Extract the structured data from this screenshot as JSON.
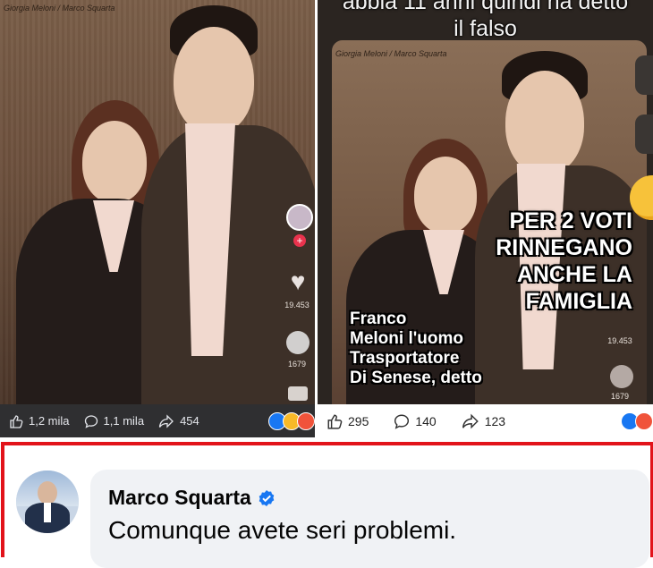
{
  "left_post": {
    "photo_credit": "Giorgia Meloni / Marco Squarta",
    "like_count": "19.453",
    "comment_count": "1679",
    "actions": {
      "likes": "1,2 mila",
      "comments": "1,1 mila",
      "shares": "454"
    }
  },
  "right_post": {
    "caption_top_line1": "abbia 11 anni quindi ha detto",
    "caption_top_line2": "il falso",
    "photo_credit": "Giorgia Meloni / Marco Squarta",
    "overlay_big": [
      "PER 2 VOTI",
      "RINNEGANO",
      "ANCHE LA",
      "FAMIGLIA"
    ],
    "overlay_small": [
      "Franco",
      "Meloni l'uomo",
      "Trasportatore",
      "Di Senese, detto"
    ],
    "side_like_count": "19.453",
    "side_comment_count": "1679",
    "actions": {
      "likes": "295",
      "comments": "140",
      "shares": "123"
    }
  },
  "comment": {
    "author": "Marco Squarta",
    "verified": true,
    "text": "Comunque avete seri problemi."
  },
  "colors": {
    "highlight_border": "#e2131a",
    "verified_blue": "#1877f2",
    "bubble_bg": "#f0f2f5"
  },
  "icons": [
    "like-icon",
    "comment-icon",
    "share-icon",
    "verified-badge-icon",
    "heart-icon"
  ]
}
